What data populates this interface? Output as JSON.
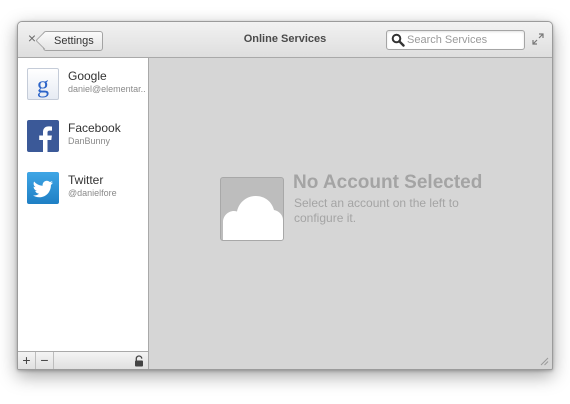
{
  "window": {
    "title": "Online Services",
    "back_label": "Settings",
    "close_glyph": "×",
    "search_placeholder": "Search Services"
  },
  "accounts": [
    {
      "service": "Google",
      "account": "daniel@elementar...",
      "icon": "google-icon"
    },
    {
      "service": "Facebook",
      "account": "DanBunny",
      "icon": "facebook-icon"
    },
    {
      "service": "Twitter",
      "account": "@danielfore",
      "icon": "twitter-icon"
    }
  ],
  "toolbar": {
    "add_glyph": "+",
    "remove_glyph": "−"
  },
  "empty_state": {
    "title": "No Account Selected",
    "description": "Select an account on the left to configure it."
  },
  "colors": {
    "facebook": "#3b5998",
    "twitter": "#2a91d6",
    "content_bg": "#d6d6d6",
    "placeholder_text": "#a4a4a4"
  }
}
